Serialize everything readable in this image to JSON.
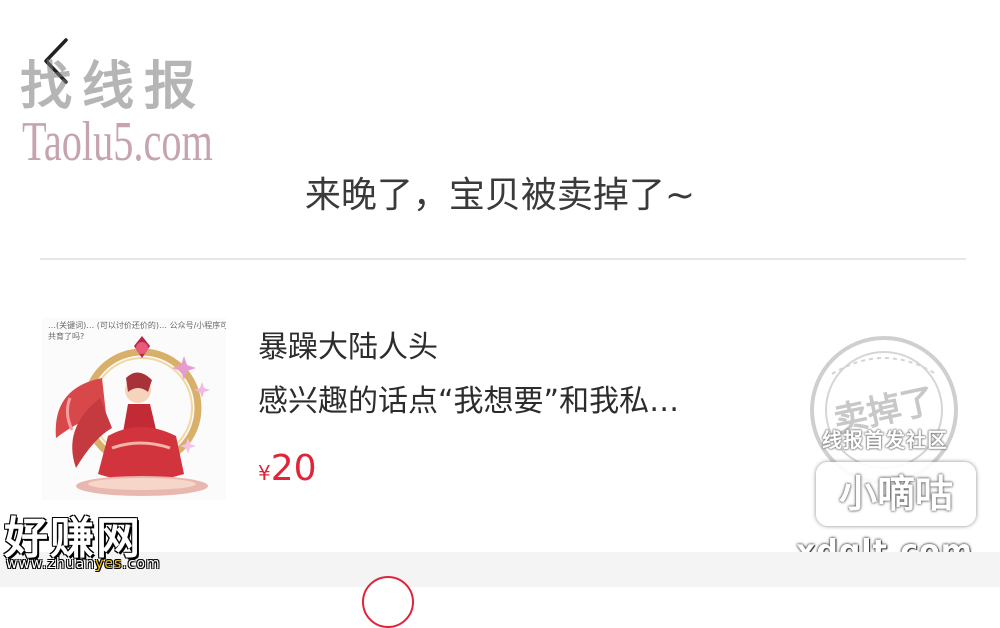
{
  "watermarks": {
    "top_left_cn": "找线报",
    "top_left_en": "Taolu5.com",
    "right_line": "线报首发社区",
    "right_box": "小嘀咕",
    "right_url": "xdglt.com",
    "bottom_left_cn": "好赚网",
    "bottom_left_url_pre": "www.zhuan",
    "bottom_left_url_hl": "yes",
    "bottom_left_url_post": ".com"
  },
  "status": {
    "message": "来晚了，宝贝被卖掉了~"
  },
  "product": {
    "thumbnail_caption_line1": "…(关键词)…  (可以讨价还价的)…  公众号/小程序可以讨价还价…",
    "thumbnail_caption_line2": "共育了吗?",
    "title": "暴躁大陆人头",
    "description": "感兴趣的话点“我想要”和我私…",
    "price_symbol": "¥",
    "price_value": "20",
    "stamp_text": "卖掉了"
  },
  "colors": {
    "price": "#e0243a",
    "divider": "#e6e6e6",
    "text": "#2c2c2c"
  },
  "icons": {
    "back": "chevron-left-icon"
  }
}
